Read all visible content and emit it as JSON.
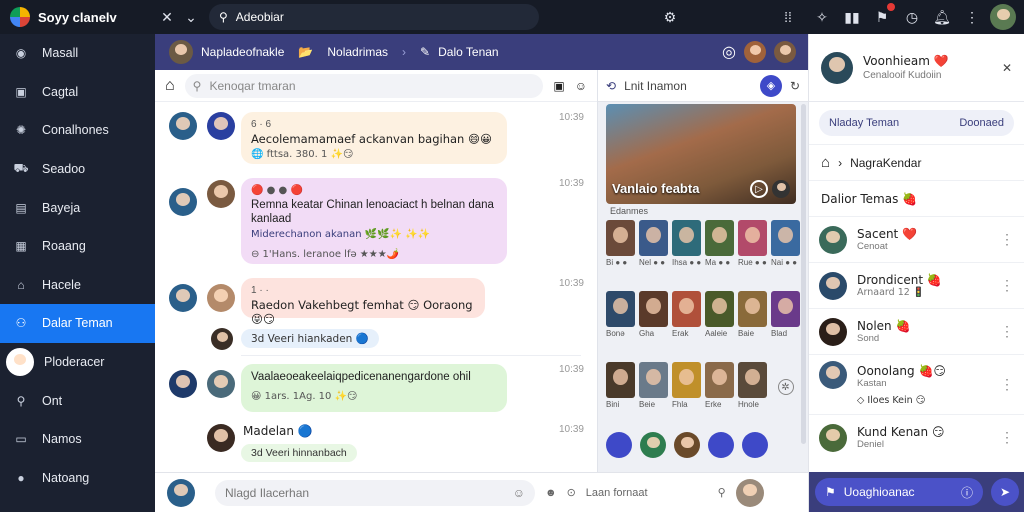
{
  "app": {
    "name": "Soyy clanelv"
  },
  "search": {
    "value": "Adeobiar"
  },
  "sidebar": {
    "items": [
      {
        "label": "Masall",
        "icon": "circle-icon"
      },
      {
        "label": "Cagtal",
        "icon": "briefcase-icon"
      },
      {
        "label": "Conalhones",
        "icon": "gear-icon"
      },
      {
        "label": "Seadoo",
        "icon": "car-icon"
      },
      {
        "label": "Bayeja",
        "icon": "document-icon"
      },
      {
        "label": "Roaang",
        "icon": "grid-icon"
      },
      {
        "label": "Hacele",
        "icon": "home-icon"
      },
      {
        "label": "Dalar Teman",
        "icon": "people-icon",
        "active": true
      },
      {
        "label": "Ploderacer",
        "icon": "avatar"
      },
      {
        "label": "Ont",
        "icon": "pin-icon"
      },
      {
        "label": "Namos",
        "icon": "inbox-icon"
      },
      {
        "label": "Natoang",
        "icon": "chat-icon"
      }
    ]
  },
  "chat_header": {
    "crumb1": "Napladeofnakle",
    "crumb2": "Noladrimas",
    "crumb3": "Dalo Tenan"
  },
  "chat_search": {
    "placeholder": "Kenoqar tmaran"
  },
  "messages": [
    {
      "title": "Aecolemamamaef ackanvan bagihan 😄😀",
      "meta": "🌐 fttsa. 380. 1 ✨😏",
      "tag": "6 · 6",
      "time": "10:39",
      "color": "#fdf1e1"
    },
    {
      "title": "Remna keatar Chinan lenoaciact h belnan dana kanlaad",
      "line2": "Miderechanon akanan 🌿🌿✨ ✨✨",
      "meta": "⊖ 1'Hans. leranoe lfə ★★★🌶️",
      "tag": "🔴 ● ● 🔴",
      "time": "10:39",
      "color": "#f2dcf6"
    },
    {
      "title": "Raedon Vakehbegt femhat 😏 Ooraong 😝😏",
      "tag": "1 · ·",
      "time": "10:39",
      "color": "#fde3de"
    },
    {
      "pill": "3d Veeri hiankaden 🔵",
      "pill_color": "#e6f0fb"
    },
    {
      "title": "Vaalaeoeakeelaiqpedicenanengardone ohil",
      "meta": "😀 1ars. 1Ag. 10 ✨😏",
      "time": "10:39",
      "color": "#def5d8"
    },
    {
      "name": "Madelan 🔵",
      "pill": "3d Veeri hinnanbach",
      "pill_color": "#e8f7e4",
      "time": "10:39"
    }
  ],
  "composer": {
    "placeholder": "Nlagd Ilacerhan",
    "right_label": "Laan fornaat"
  },
  "media": {
    "header": "Lnit Inamon",
    "feature_caption": "Vanlaio feabta",
    "feature_sub": "Edanmes",
    "rows": [
      [
        "Bi ● ●",
        "Nel ● ●",
        "Ihsa ● ●",
        "Ma ● ●",
        "Rue ● ●",
        "Nai ● ●"
      ],
      [
        "Bonə",
        "Gha",
        "Erak",
        "Aaleie",
        "Baie",
        "Blad"
      ],
      [
        "Bini",
        "Beie",
        "Fhla",
        "Erke",
        "Hnole"
      ]
    ],
    "foot_colors": [
      "#3e49c8",
      "#2e7d4f",
      "#6a4a2a",
      "#3e49c8",
      "#3e49c8"
    ]
  },
  "friends": {
    "user_name": "Voonhieam ❤️",
    "user_sub": "Cenalooif Kudoiin",
    "tab_left": "Nladay Teman",
    "tab_right": "Doonaed",
    "crumb": "NagraKendar",
    "list_title": "Dalior Temas 🍓",
    "items": [
      {
        "name": "Sacent ❤️",
        "sub": "Cenoat"
      },
      {
        "name": "Drondicent 🍓",
        "sub": "Arnaard 12 🚦"
      },
      {
        "name": "Nolen 🍓",
        "sub": "Sond"
      },
      {
        "name": "Oonolang 🍓😏",
        "sub": "Kastan",
        "extra": "◇ Iloes Kein 😏"
      },
      {
        "name": "Kund Kenan 😏",
        "sub": "Deniel"
      }
    ],
    "footer_button": "Uoaghioanac"
  },
  "colors": {
    "accent": "#1877f2",
    "header": "#3a3e7c",
    "dark": "#161b26",
    "sidebar": "#1b2130"
  }
}
